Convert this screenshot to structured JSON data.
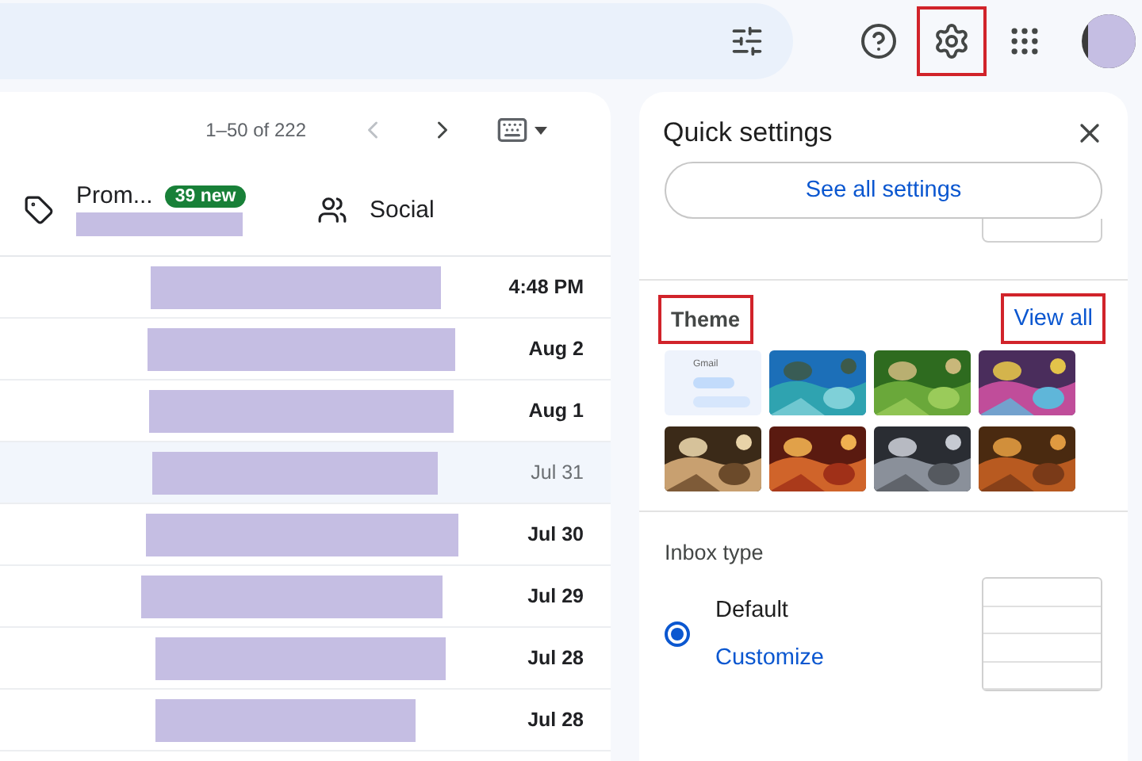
{
  "top_bar": {
    "settings_highlighted": true
  },
  "mail": {
    "page_range": "1–50 of 222",
    "tabs": [
      {
        "kind": "promotions",
        "label": "Prom...",
        "badge": "39 new",
        "selected": false
      },
      {
        "kind": "social",
        "label": "Social",
        "selected": false
      }
    ],
    "rows": [
      {
        "date": "4:48 PM",
        "unread": true
      },
      {
        "date": "Aug 2",
        "unread": true
      },
      {
        "date": "Aug 1",
        "unread": true
      },
      {
        "date": "Jul 31",
        "unread": false
      },
      {
        "date": "Jul 30",
        "unread": true
      },
      {
        "date": "Jul 29",
        "unread": true
      },
      {
        "date": "Jul 28",
        "unread": true
      },
      {
        "date": "Jul 28",
        "unread": true
      }
    ]
  },
  "quick_settings": {
    "title": "Quick settings",
    "see_all": "See all settings",
    "theme": {
      "label": "Theme",
      "label_highlighted": true,
      "view_all": "View all",
      "view_all_highlighted": true,
      "default_theme_brand": "Gmail",
      "thumbnails": [
        {
          "kind": "default"
        },
        {
          "kind": "picture"
        },
        {
          "kind": "picture"
        },
        {
          "kind": "picture"
        },
        {
          "kind": "picture"
        },
        {
          "kind": "picture"
        },
        {
          "kind": "picture"
        },
        {
          "kind": "picture"
        }
      ]
    },
    "inbox_type": {
      "label": "Inbox type",
      "options": [
        {
          "label": "Default",
          "selected": true,
          "action": "Customize"
        }
      ]
    }
  }
}
